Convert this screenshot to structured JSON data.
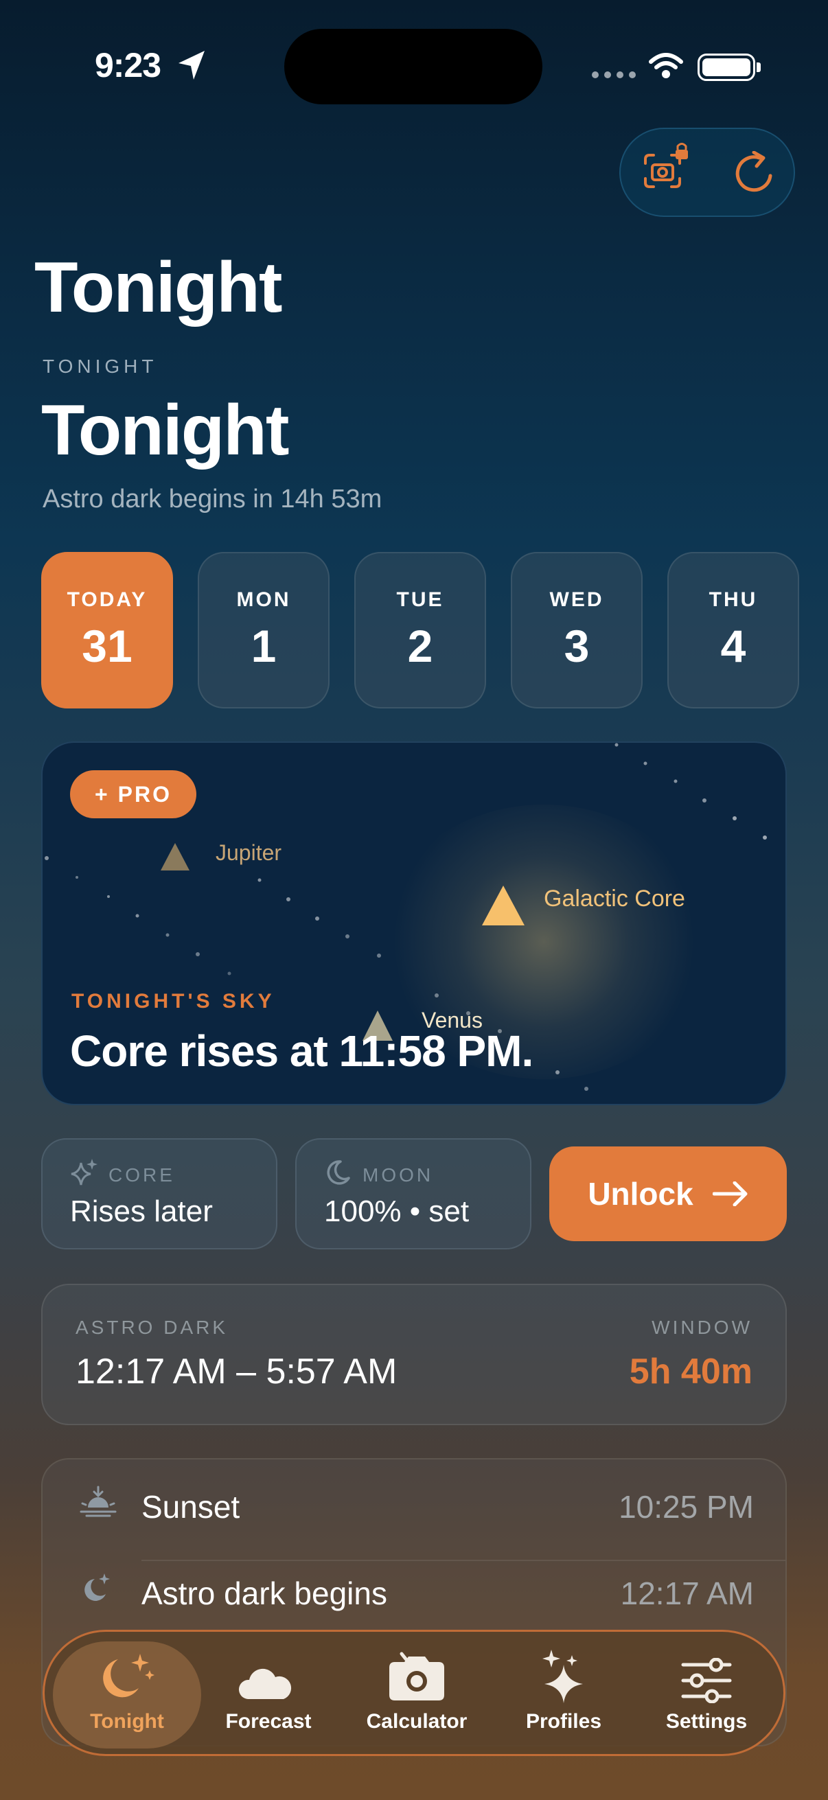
{
  "status_bar": {
    "time": "9:23"
  },
  "header": {
    "title": "Tonight"
  },
  "section": {
    "eyebrow": "TONIGHT",
    "title": "Tonight",
    "subtitle": "Astro dark begins in 14h 53m"
  },
  "days": [
    {
      "name": "TODAY",
      "num": "31",
      "selected": true
    },
    {
      "name": "MON",
      "num": "1",
      "selected": false
    },
    {
      "name": "TUE",
      "num": "2",
      "selected": false
    },
    {
      "name": "WED",
      "num": "3",
      "selected": false
    },
    {
      "name": "THU",
      "num": "4",
      "selected": false
    }
  ],
  "sky_card": {
    "badge": "+ PRO",
    "objects": {
      "jupiter": "Jupiter",
      "core": "Galactic Core",
      "venus": "Venus"
    },
    "eyebrow": "TONIGHT'S SKY",
    "headline": "Core rises at 11:58 PM."
  },
  "stats": {
    "core_label": "CORE",
    "core_value": "Rises later",
    "moon_label": "MOON",
    "moon_value": "100% • set",
    "unlock_label": "Unlock"
  },
  "astro_dark": {
    "label": "ASTRO DARK",
    "range": "12:17 AM – 5:57 AM",
    "window_label": "WINDOW",
    "window_value": "5h 40m"
  },
  "events": [
    {
      "name": "Sunset",
      "time": "10:25 PM",
      "icon": "sunset-icon"
    },
    {
      "name": "Astro dark begins",
      "time": "12:17 AM",
      "icon": "moon-stars-icon"
    }
  ],
  "tabs": [
    {
      "label": "Tonight",
      "icon": "moon-stars-icon",
      "active": true
    },
    {
      "label": "Forecast",
      "icon": "cloud-moon-icon",
      "active": false
    },
    {
      "label": "Calculator",
      "icon": "camera-icon",
      "active": false
    },
    {
      "label": "Profiles",
      "icon": "sparkles-icon",
      "active": false
    },
    {
      "label": "Settings",
      "icon": "sliders-icon",
      "active": false
    }
  ],
  "colors": {
    "accent": "#e27b3c",
    "core_glow": "#f1c27a"
  }
}
